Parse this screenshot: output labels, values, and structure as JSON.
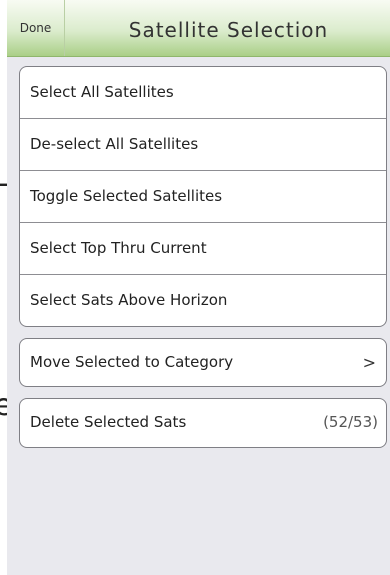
{
  "header": {
    "done_label": "Done",
    "title": "Satellite Selection"
  },
  "selection_actions": [
    {
      "label": "Select All Satellites"
    },
    {
      "label": "De-select All Satellites"
    },
    {
      "label": "Toggle Selected Satellites"
    },
    {
      "label": "Select Top Thru Current"
    },
    {
      "label": "Select Sats Above Horizon"
    }
  ],
  "category_action": {
    "label": "Move Selected to Category",
    "chevron": ">"
  },
  "delete_action": {
    "label": "Delete Selected Sats",
    "count": "(52/53)"
  },
  "background_fragments": {
    "glyph_1": "-",
    "glyph_2": "e"
  },
  "colors": {
    "header_gradient_top": "#f8fbf3",
    "header_gradient_bottom": "#aacf87",
    "panel_background": "#e9e9ee",
    "cell_background": "#ffffff",
    "cell_border": "#7f7f85"
  },
  "icons": {
    "disclosure": "chevron-right-icon"
  }
}
